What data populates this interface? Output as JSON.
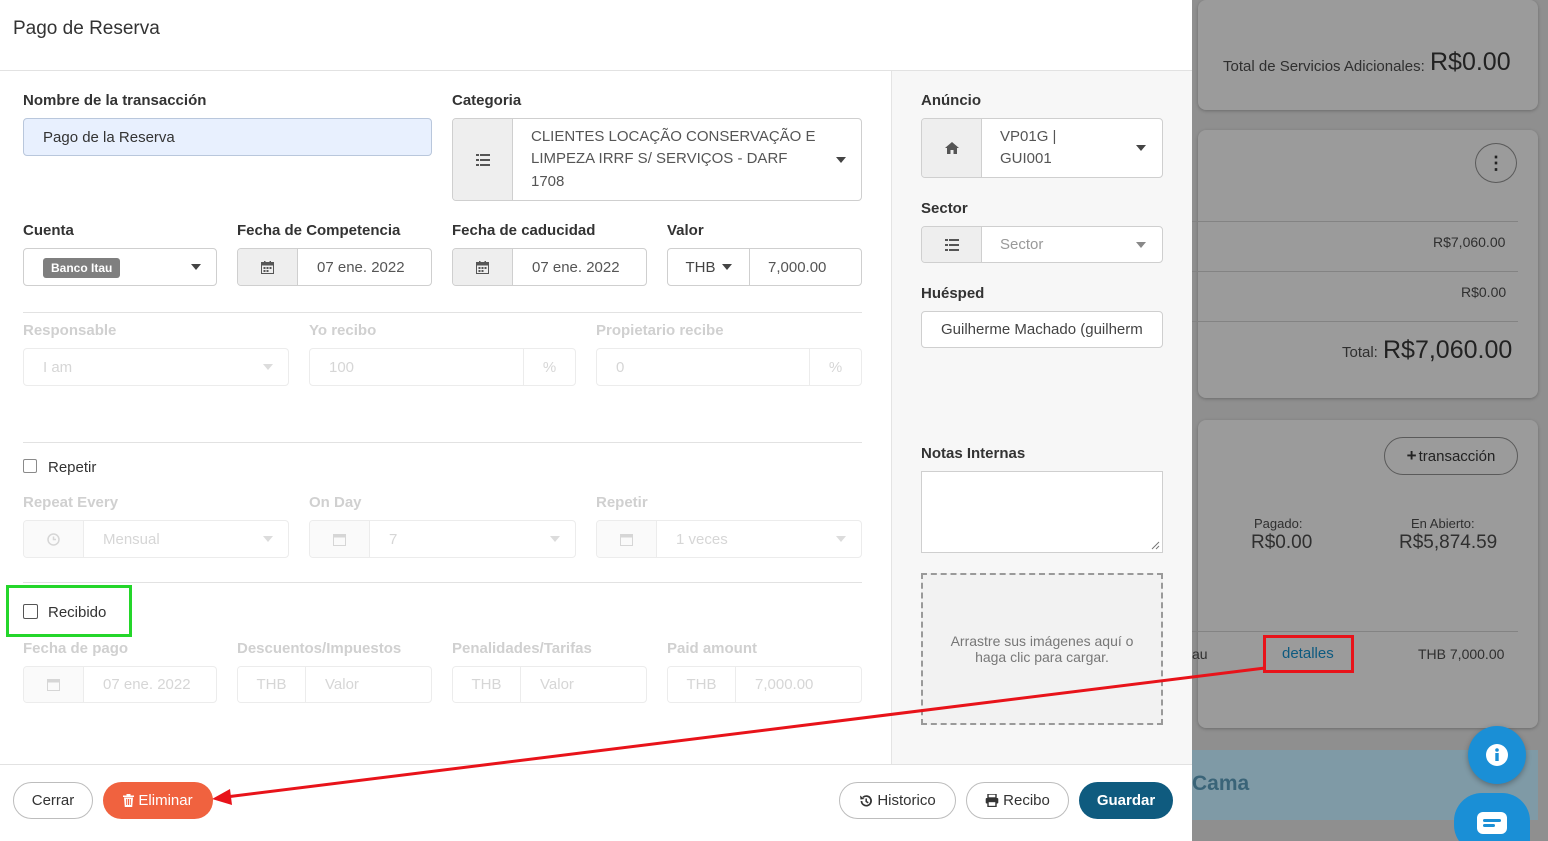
{
  "modal": {
    "title": "Pago de Reserva"
  },
  "fields": {
    "nombre_label": "Nombre de la transacción",
    "nombre_value": "Pago de la Reserva",
    "categoria_label": "Categoria",
    "categoria_line1": "CLIENTES LOCAÇÃO CONSERVAÇÃO E",
    "categoria_line2": "LIMPEZA IRRF S/ SERVIÇOS - DARF",
    "categoria_line3": "1708",
    "cuenta_label": "Cuenta",
    "cuenta_value": "Banco Itau",
    "competencia_label": "Fecha de Competencia",
    "competencia_value": "07 ene. 2022",
    "caducidad_label": "Fecha de caducidad",
    "caducidad_value": "07 ene. 2022",
    "valor_label": "Valor",
    "valor_currency": "THB",
    "valor_value": "7,000.00",
    "responsable_label": "Responsable",
    "responsable_value": "I am",
    "yo_recibo_label": "Yo recibo",
    "yo_recibo_value": "100",
    "propietario_label": "Propietario recibe",
    "propietario_value": "0",
    "percent": "%",
    "repetir_check": "Repetir",
    "repeat_every_label": "Repeat Every",
    "repeat_every_value": "Mensual",
    "on_day_label": "On Day",
    "on_day_value": "7",
    "repetir_label": "Repetir",
    "repetir_value": "1 veces",
    "recibido_check": "Recibido",
    "fecha_pago_label": "Fecha de pago",
    "fecha_pago_value": "07 ene. 2022",
    "descuentos_label": "Descuentos/Impuestos",
    "descuentos_currency": "THB",
    "descuentos_placeholder": "Valor",
    "penalidades_label": "Penalidades/Tarifas",
    "penalidades_currency": "THB",
    "penalidades_placeholder": "Valor",
    "paid_label": "Paid amount",
    "paid_currency": "THB",
    "paid_value": "7,000.00"
  },
  "right": {
    "anuncio_label": "Anúncio",
    "anuncio_line1": "VP01G |",
    "anuncio_line2": "GUI001",
    "sector_label": "Sector",
    "sector_placeholder": "Sector",
    "huesped_label": "Huésped",
    "huesped_value": "Guilherme Machado (guilherm",
    "notas_label": "Notas Internas",
    "dropzone_text": "Arrastre sus imágenes aquí o haga clic para cargar."
  },
  "footer": {
    "cerrar": "Cerrar",
    "eliminar": "Eliminar",
    "historico": "Historico",
    "recibo": "Recibo",
    "guardar": "Guardar"
  },
  "background": {
    "servicios_label": "Total de Servicios Adicionales:",
    "servicios_value": "R$0.00",
    "row1_value": "R$7,060.00",
    "row2_value": "R$0.00",
    "total_label": "Total:",
    "total_value": "R$7,060.00",
    "add_transaction": "transacción",
    "pagado_label": "Pagado:",
    "pagado_value": "R$0.00",
    "abierto_label": "En Abierto:",
    "abierto_value": "R$5,874.59",
    "cuenta_fragment": "au",
    "detalles": "detalles",
    "amount": "THB 7,000.00",
    "cama": "Cama"
  },
  "colors": {
    "primary": "#0f5b7f",
    "danger": "#f0623f",
    "highlight_green": "#24d62a",
    "highlight_red": "#e8131a",
    "input_active": "#e8f0fe"
  }
}
